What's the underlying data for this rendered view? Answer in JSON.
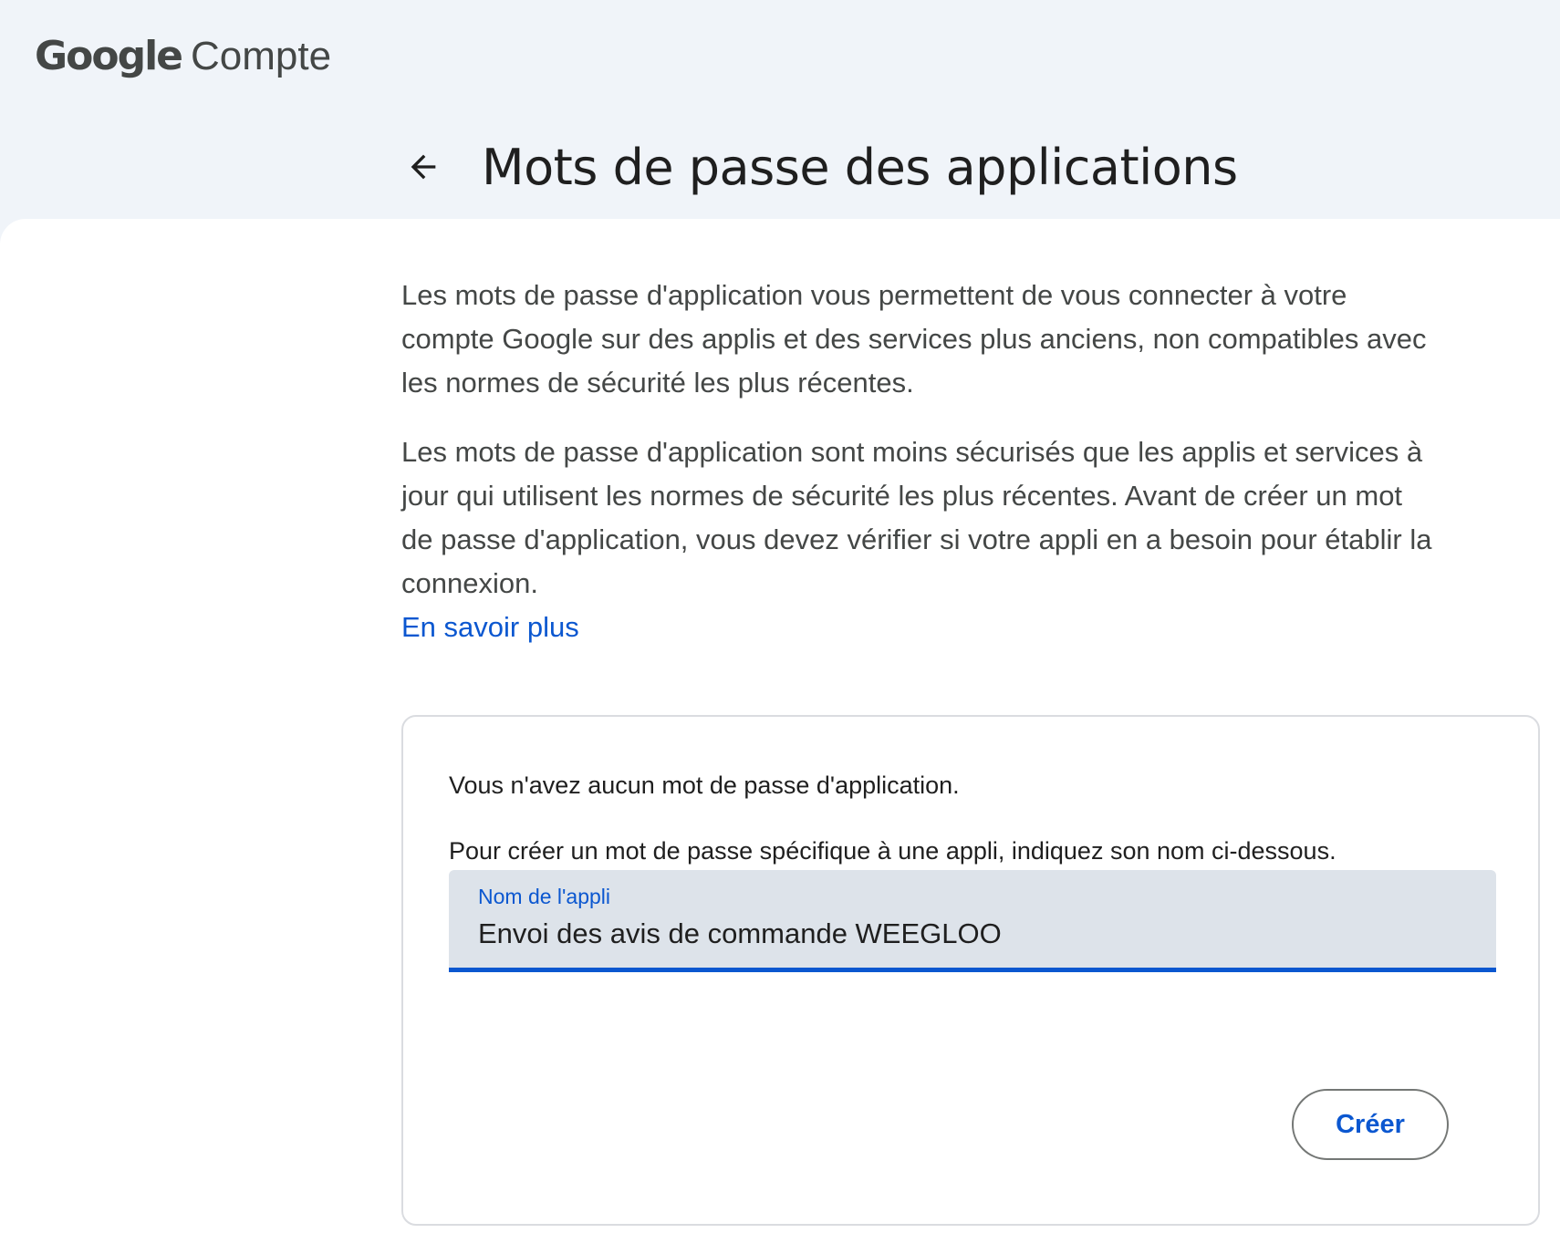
{
  "header": {
    "logo_brand": "Google",
    "logo_product": "Compte",
    "back_icon": "arrow-left-icon",
    "title": "Mots de passe des applications"
  },
  "description": {
    "paragraph_1": "Les mots de passe d'application vous permettent de vous connecter à votre compte Google sur des applis et des services plus anciens, non compatibles avec les normes de sécurité les plus récentes.",
    "paragraph_2": "Les mots de passe d'application sont moins sécurisés que les applis et services à jour qui utilisent les normes de sécurité les plus récentes. Avant de créer un mot de passe d'application, vous devez vérifier si votre appli en a besoin pour établir la connexion.",
    "learn_more": "En savoir plus"
  },
  "card": {
    "no_passwords": "Vous n'avez aucun mot de passe d'application.",
    "instructions": "Pour créer un mot de passe spécifique à une appli, indiquez son nom ci-dessous.",
    "field_label": "Nom de l'appli",
    "field_value": "Envoi des avis de commande WEEGLOO",
    "create_button": "Créer"
  },
  "colors": {
    "accent": "#0b57d0",
    "header_bg": "#f0f4f9",
    "field_bg": "#dde3ea"
  }
}
